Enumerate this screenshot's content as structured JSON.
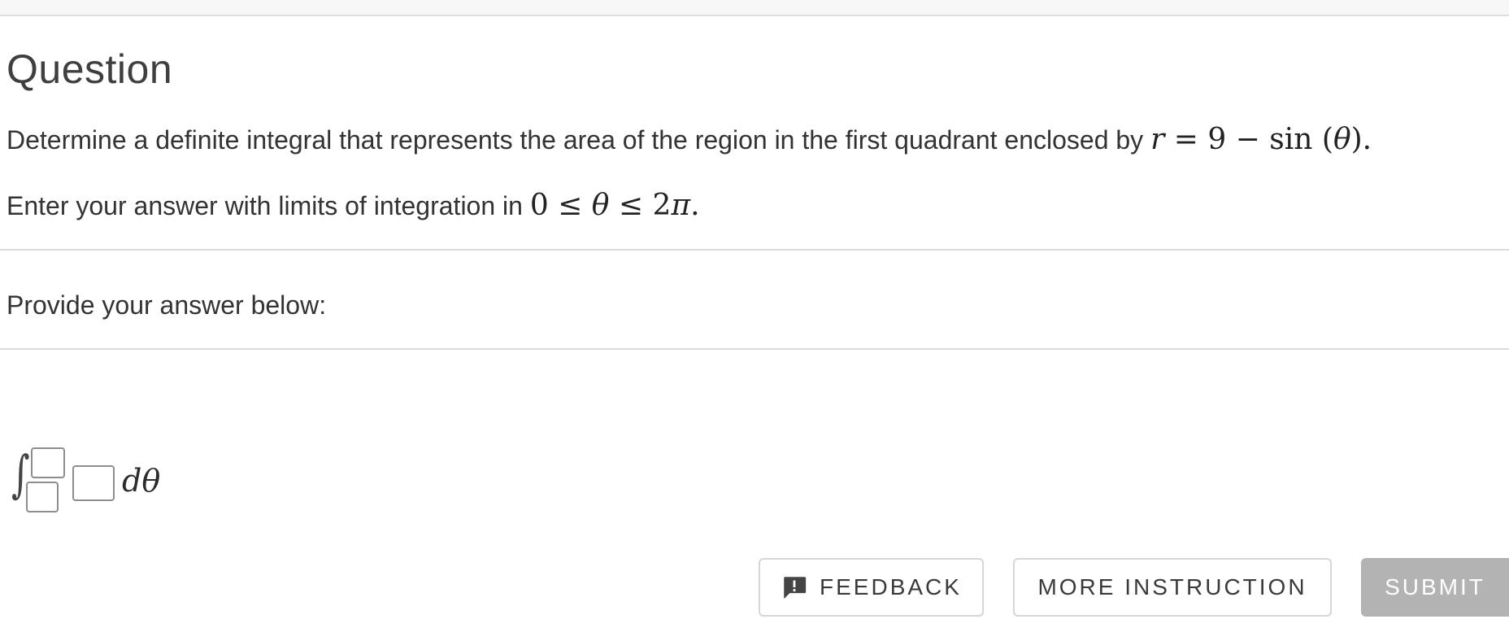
{
  "section": {
    "title": "Question"
  },
  "question": {
    "prompt_text": "Determine a definite integral that represents the area of the region in the first quadrant enclosed by",
    "equation": {
      "lhs": "r",
      "eq": " = 9 − sin (",
      "var": "θ",
      "close": ")."
    },
    "instruction_text": "Enter your answer with limits of integration in",
    "limits": {
      "low": "0 ≤ ",
      "var": "θ",
      "high": " ≤ 2",
      "pi": "π",
      "end": "."
    }
  },
  "answer": {
    "label": "Provide your answer below:",
    "integral_symbol": "∫",
    "upper_limit_value": "",
    "lower_limit_value": "",
    "integrand_value": "",
    "differential": "dθ"
  },
  "actions": {
    "feedback_label": "FEEDBACK",
    "feedback_icon": "feedback-exclamation-icon",
    "more_instruction_label": "MORE INSTRUCTION",
    "submit_label": "SUBMIT",
    "submit_enabled": false
  },
  "colors": {
    "submit_disabled_bg": "#b3b3b3",
    "border": "#d6d6d6",
    "text": "#333333"
  }
}
